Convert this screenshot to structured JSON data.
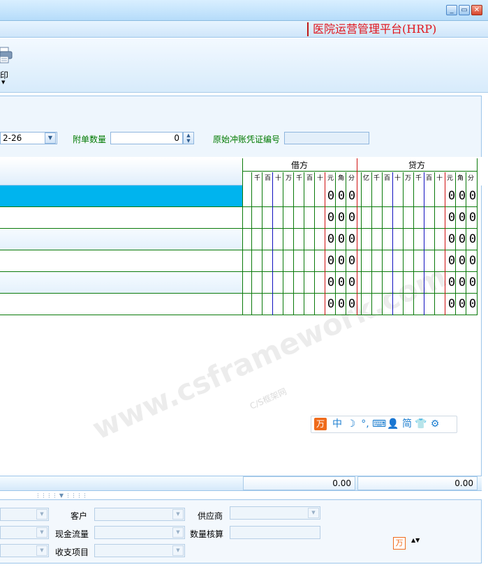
{
  "window": {
    "app_title": "医院运营管理平台(HRP)",
    "minimize_glyph": "_",
    "restore_glyph": "▭",
    "close_glyph": "✕"
  },
  "toolbar": {
    "print_label": "印",
    "print_caret": "▼",
    "print_icon": "printer-icon"
  },
  "form": {
    "date_value": "2-26",
    "attach_label": "附单数量",
    "attach_value": "0",
    "orig_voucher_label": "原始冲账凭证编号",
    "orig_voucher_value": ""
  },
  "grid": {
    "debit_title": "借方",
    "credit_title": "贷方",
    "debit_digits": [
      "千",
      "百",
      "十",
      "万",
      "千",
      "百",
      "十",
      "元",
      "角",
      "分"
    ],
    "credit_digits": [
      "亿",
      "千",
      "百",
      "十",
      "万",
      "千",
      "百",
      "十",
      "元",
      "角",
      "分"
    ],
    "rows": [
      {
        "debit": [
          "0",
          "0",
          "0"
        ],
        "credit": [
          "0",
          "0",
          "0"
        ]
      },
      {
        "debit": [
          "0",
          "0",
          "0"
        ],
        "credit": [
          "0",
          "0",
          "0"
        ]
      },
      {
        "debit": [
          "0",
          "0",
          "0"
        ],
        "credit": [
          "0",
          "0",
          "0"
        ]
      },
      {
        "debit": [
          "0",
          "0",
          "0"
        ],
        "credit": [
          "0",
          "0",
          "0"
        ]
      },
      {
        "debit": [
          "0",
          "0",
          "0"
        ],
        "credit": [
          "0",
          "0",
          "0"
        ]
      },
      {
        "debit": [
          "0",
          "0",
          "0"
        ],
        "credit": [
          "0",
          "0",
          "0"
        ]
      }
    ],
    "selected_row": 0
  },
  "totals": {
    "debit_total": "0.00",
    "credit_total": "0.00"
  },
  "ime": {
    "logo": "万",
    "items": [
      "中",
      "☽",
      "°,",
      "⌨",
      "👤",
      "简",
      "👕",
      "⚙"
    ]
  },
  "watermark": {
    "main": "www.csframework.com",
    "sub": "C/S框架网"
  },
  "bottom": {
    "customer_label": "客户",
    "cashflow_label": "现金流量",
    "income_label": "收支项目",
    "supplier_label": "供应商",
    "qty_label": "数量核算",
    "ime_small": "万",
    "ime_small_caret": "▲▼"
  },
  "colors": {
    "title_red": "#e0141a",
    "label_green": "#007a00",
    "selected_row": "#00b4ee",
    "grid_line_green": "#0a7a0a",
    "grid_line_red": "#d01010",
    "grid_line_blue": "#1010c0"
  }
}
